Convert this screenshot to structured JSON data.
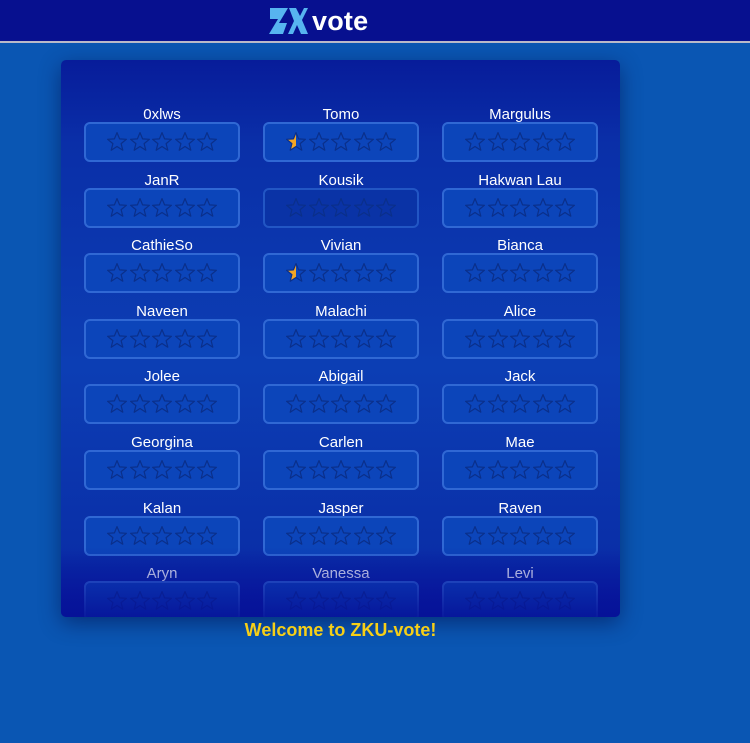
{
  "header": {
    "brand_text": "vote",
    "logo_icon": "zk-logo-icon"
  },
  "colors": {
    "page_bg": "#0a56b3",
    "topbar_bg": "#07108f",
    "star_outline": "#0a2f8a",
    "star_fill": "#f5a623",
    "welcome": "#f6cf17"
  },
  "candidates": [
    {
      "name": "0xlws",
      "rating": 0
    },
    {
      "name": "Tomo",
      "rating": 0.5
    },
    {
      "name": "Margulus",
      "rating": 0
    },
    {
      "name": "JanR",
      "rating": 0
    },
    {
      "name": "Kousik",
      "rating": 0,
      "focused": true
    },
    {
      "name": "Hakwan Lau",
      "rating": 0
    },
    {
      "name": "CathieSo",
      "rating": 0
    },
    {
      "name": "Vivian",
      "rating": 0.5
    },
    {
      "name": "Bianca",
      "rating": 0
    },
    {
      "name": "Naveen",
      "rating": 0
    },
    {
      "name": "Malachi",
      "rating": 0
    },
    {
      "name": "Alice",
      "rating": 0
    },
    {
      "name": "Jolee",
      "rating": 0
    },
    {
      "name": "Abigail",
      "rating": 0
    },
    {
      "name": "Jack",
      "rating": 0
    },
    {
      "name": "Georgina",
      "rating": 0
    },
    {
      "name": "Carlen",
      "rating": 0
    },
    {
      "name": "Mae",
      "rating": 0
    },
    {
      "name": "Kalan",
      "rating": 0
    },
    {
      "name": "Jasper",
      "rating": 0
    },
    {
      "name": "Raven",
      "rating": 0
    },
    {
      "name": "Aryn",
      "rating": 0
    },
    {
      "name": "Vanessa",
      "rating": 0
    },
    {
      "name": "Levi",
      "rating": 0
    }
  ],
  "max_stars": 5,
  "star_icon": "star-icon",
  "welcome_text": "Welcome to ZKU-vote!"
}
